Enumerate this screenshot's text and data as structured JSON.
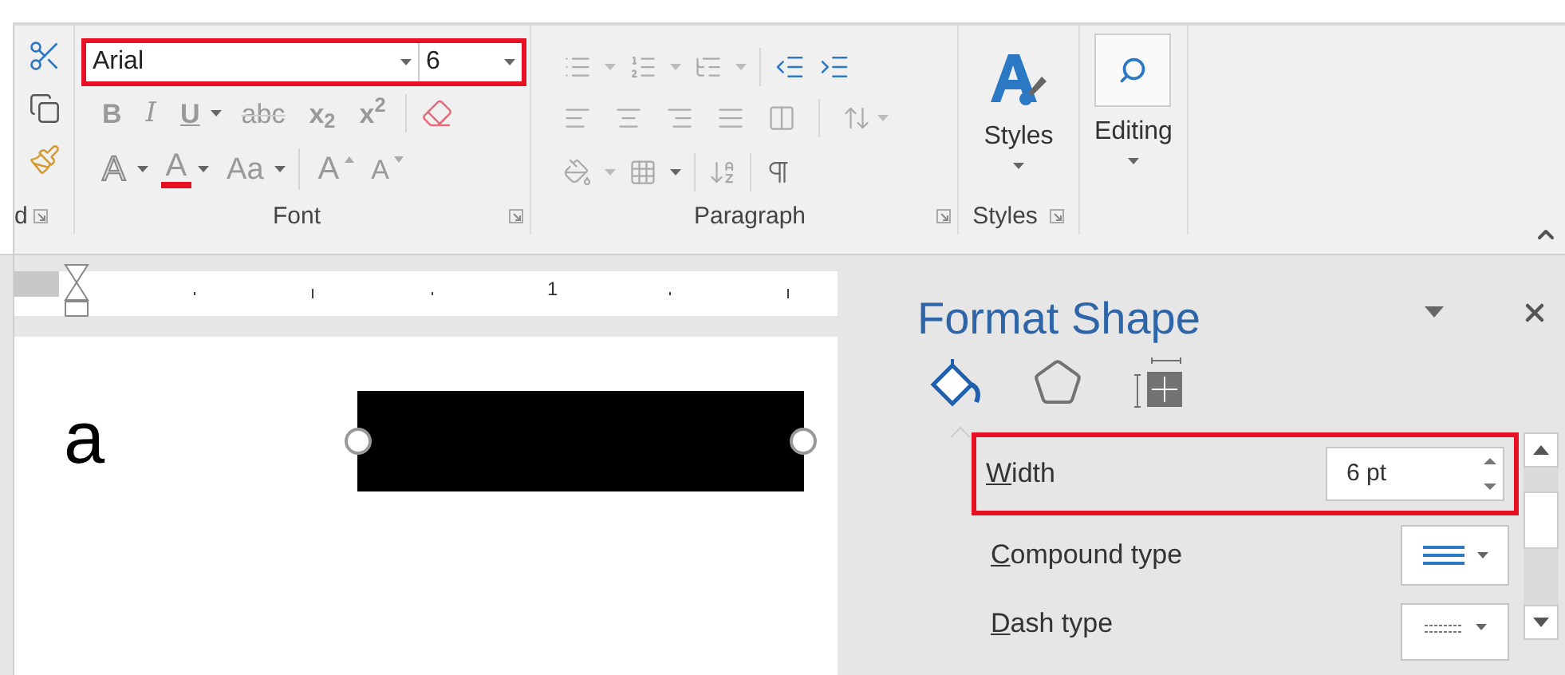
{
  "ribbon": {
    "clipboard": {
      "label": "d"
    },
    "font": {
      "name": "Arial",
      "size": "6",
      "highlighted": true,
      "label": "Font",
      "row2": [
        {
          "label": "B",
          "kind": "bold"
        },
        {
          "label": "I",
          "kind": "italic"
        },
        {
          "label": "U",
          "kind": "underline",
          "caret": true
        },
        {
          "label": "abc",
          "kind": "strike"
        },
        {
          "label": "x$_{2}$",
          "kind": "script"
        },
        {
          "label": "x$^{2}$",
          "kind": "script"
        }
      ],
      "row3": [
        {
          "label": "A",
          "kind": "effects",
          "caret": true
        },
        {
          "label": "A",
          "kind": "color",
          "caret": true
        },
        {
          "label": "Aa",
          "kind": "case",
          "caret": true
        },
        {
          "label": "A",
          "kind": "grow"
        },
        {
          "label": "A",
          "kind": "shrink"
        }
      ]
    },
    "paragraph": {
      "label": "Paragraph"
    },
    "styles": {
      "button": "Styles",
      "label": "Styles"
    },
    "editing": {
      "button": "Editing"
    }
  },
  "document": {
    "ruler_mark": "1",
    "text": "a"
  },
  "panel": {
    "title": "Format Shape",
    "tabs": [
      {
        "kind": "fill",
        "selected": true
      },
      {
        "kind": "effects",
        "selected": false
      },
      {
        "kind": "size",
        "selected": false
      }
    ],
    "rows": [
      {
        "kind": "spinner",
        "accel": "W",
        "rest": "idth",
        "value": "6 pt",
        "highlighted": true
      },
      {
        "kind": "compound",
        "accel": "C",
        "rest": "ompound type",
        "highlighted": false
      },
      {
        "kind": "dash",
        "accel": "D",
        "rest": "ash type",
        "highlighted": false
      }
    ]
  }
}
